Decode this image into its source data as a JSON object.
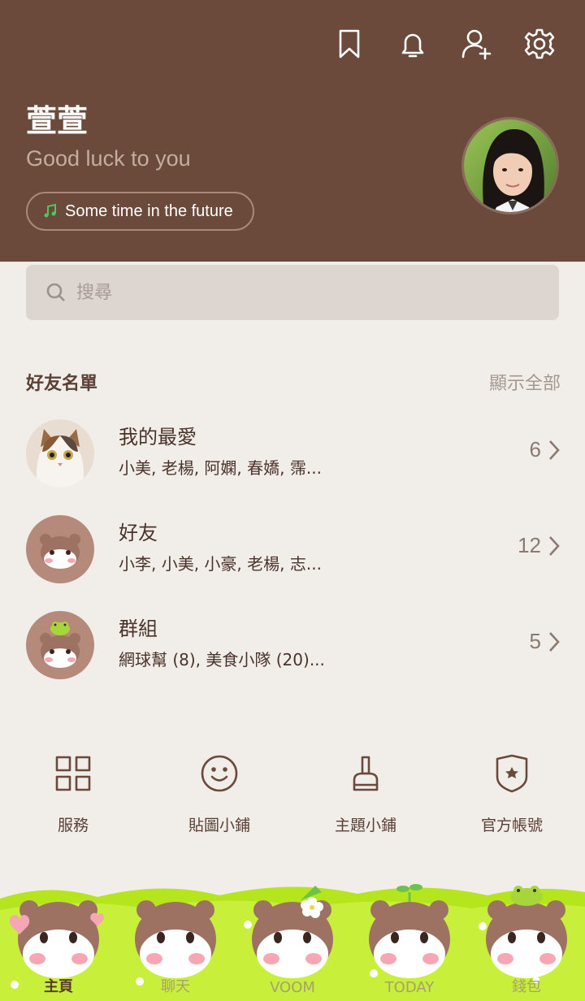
{
  "header": {
    "icons": [
      "bookmark-icon",
      "bell-icon",
      "add-friend-icon",
      "gear-icon"
    ],
    "name": "萱萱",
    "status": "Good luck to you",
    "music": "Some time in the future"
  },
  "search": {
    "placeholder": "搜尋"
  },
  "friends": {
    "title": "好友名單",
    "show_all": "顯示全部",
    "rows": [
      {
        "title": "我的最愛",
        "subtitle": "小美, 老楊, 阿嫻, 春嬌, 霈...",
        "count": "6"
      },
      {
        "title": "好友",
        "subtitle": "小李, 小美, 小豪, 老楊, 志...",
        "count": "12"
      },
      {
        "title": "群組",
        "subtitle": "網球幫 (8), 美食小隊 (20)...",
        "count": "5"
      }
    ]
  },
  "services": [
    {
      "label": "服務",
      "icon": "grid-icon"
    },
    {
      "label": "貼圖小鋪",
      "icon": "smiley-icon"
    },
    {
      "label": "主題小鋪",
      "icon": "brush-icon"
    },
    {
      "label": "官方帳號",
      "icon": "shield-star-icon"
    }
  ],
  "tabs": [
    {
      "label": "主頁",
      "active": true
    },
    {
      "label": "聊天",
      "active": false
    },
    {
      "label": "VOOM",
      "active": false
    },
    {
      "label": "TODAY",
      "active": false
    },
    {
      "label": "錢包",
      "active": false
    }
  ],
  "colors": {
    "header_bg": "#6b4a3c",
    "page_bg": "#f1ede8",
    "accent_green": "#b5e61d"
  }
}
